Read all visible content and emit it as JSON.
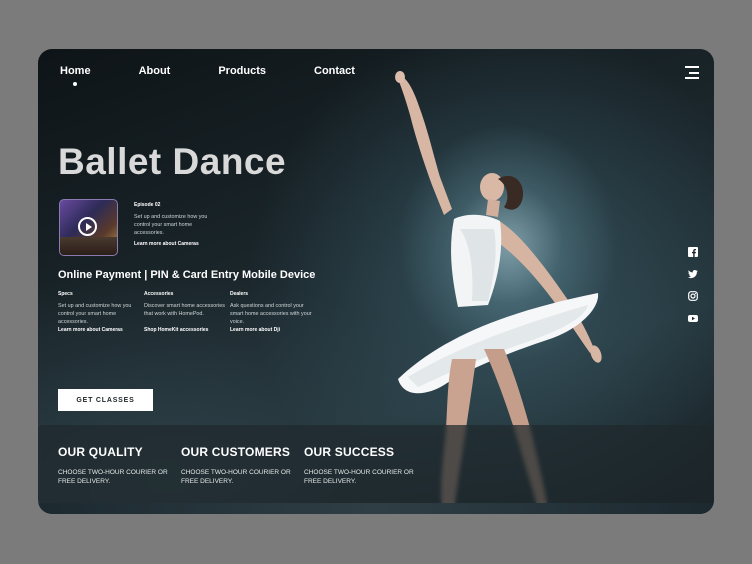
{
  "nav": {
    "items": [
      {
        "label": "Home",
        "active": true
      },
      {
        "label": "About"
      },
      {
        "label": "Products"
      },
      {
        "label": "Contact"
      }
    ]
  },
  "hero": {
    "title": "Ballet Dance",
    "episode": {
      "title": "Episode 02",
      "desc": "Set up and customize how you control your smart home accessories.",
      "link": "Learn more about Cameras"
    },
    "subtitle": "Online Payment | PIN & Card Entry Mobile Device",
    "columns": [
      {
        "title": "Specs",
        "desc": "Set up and customize how you control your smart home accessories.",
        "link": "Learn more about Cameras"
      },
      {
        "title": "Accessories",
        "desc": "Discover smart home accessories that work with HomePod.",
        "link": "Shop HomeKit accessories"
      },
      {
        "title": "Dealers",
        "desc": "Ask questions and control your smart home accessories with your voice.",
        "link": "Learn more about Dji"
      }
    ],
    "cta": "GET CLASSES"
  },
  "social": [
    "facebook-icon",
    "twitter-icon",
    "instagram-icon",
    "youtube-icon"
  ],
  "features": [
    {
      "title": "OUR QUALITY",
      "desc": "CHOOSE TWO-HOUR COURIER OR FREE DELIVERY."
    },
    {
      "title": "OUR CUSTOMERS",
      "desc": "CHOOSE TWO-HOUR COURIER OR FREE DELIVERY."
    },
    {
      "title": "OUR SUCCESS",
      "desc": "CHOOSE TWO-HOUR COURIER OR FREE DELIVERY."
    }
  ],
  "colors": {
    "background": "#7b7b7b",
    "card": "#1b272c",
    "accent": "#ffffff"
  }
}
